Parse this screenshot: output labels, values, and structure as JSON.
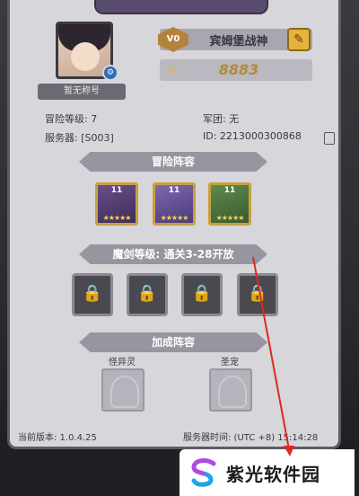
{
  "profile": {
    "no_title": "暂无称号",
    "vip_label": "V0",
    "name": "宾姆堡战神",
    "power": "8883"
  },
  "info": {
    "adventure_level": "冒险等级: 7",
    "legion": "军团: 无",
    "server": "服务器: [S003]",
    "id": "ID: 2213000300868"
  },
  "sections": {
    "adventure_team": "冒险阵容",
    "magic_sword": "魔剑等级: 通关3-28开放",
    "bonus_team": "加成阵容"
  },
  "heroes": [
    {
      "level": "11",
      "stars": "★★★★★"
    },
    {
      "level": "11",
      "stars": "★★★★★"
    },
    {
      "level": "11",
      "stars": "★★★★★"
    }
  ],
  "bonus": {
    "left_label": "怪异灵",
    "right_label": "圣宠"
  },
  "footer": {
    "version": "当前版本: 1.0.4.25",
    "server_time": "服务器时间: (UTC +8) 15:14:28"
  },
  "brand": {
    "name": "紫光软件园"
  },
  "colors": {
    "accent": "#e6b23a",
    "panel": "#d7d6da",
    "arrow": "#e0281f"
  }
}
